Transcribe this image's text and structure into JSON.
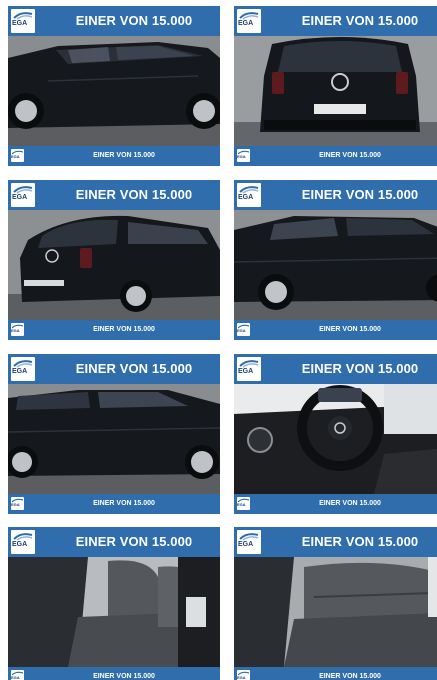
{
  "tiles": [
    {
      "title": "EINER VON 15.000",
      "caption": "EINER VON 15.000",
      "logo": "EGA",
      "view": "car-side-front"
    },
    {
      "title": "EINER VON 15.000",
      "caption": "EINER VON 15.000",
      "logo": "EGA",
      "view": "car-rear"
    },
    {
      "title": "EINER VON 15.000",
      "caption": "EINER VON 15.000",
      "logo": "EGA",
      "view": "car-rear-quarter"
    },
    {
      "title": "EINER VON 15.000",
      "caption": "EINER VON 15.000",
      "logo": "EGA",
      "view": "car-side-rear"
    },
    {
      "title": "EINER VON 15.000",
      "caption": "EINER VON 15.000",
      "logo": "EGA",
      "view": "car-side-front-2"
    },
    {
      "title": "EINER VON 15.000",
      "caption": "EINER VON 15.000",
      "logo": "EGA",
      "view": "interior-dashboard"
    },
    {
      "title": "EINER VON 15.000",
      "caption": "EINER VON 15.000",
      "logo": "EGA",
      "view": "interior-front-seats"
    },
    {
      "title": "EINER VON 15.000",
      "caption": "EINER VON 15.000",
      "logo": "EGA",
      "view": "interior-rear-seats"
    }
  ],
  "colors": {
    "banner": "#2f6dac",
    "car_paint": "#14171c",
    "logo_text": "#1f3e6e"
  }
}
